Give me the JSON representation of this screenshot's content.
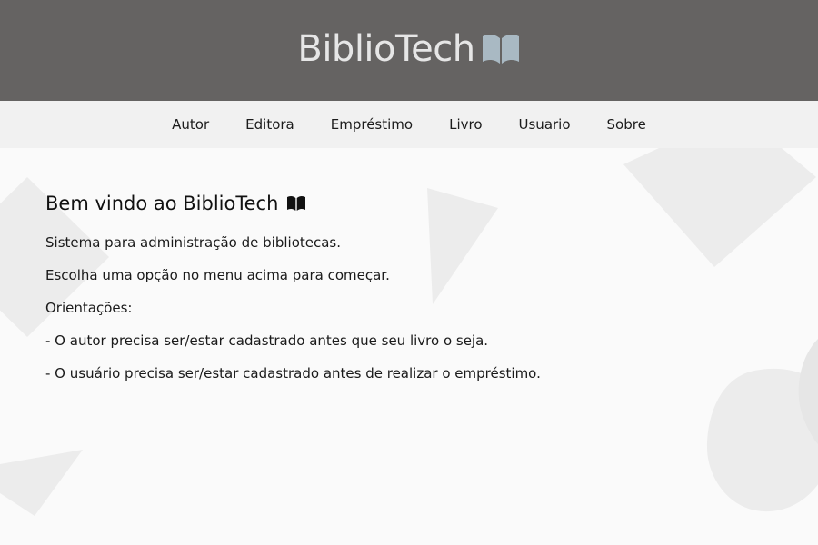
{
  "header": {
    "logo_text": "BiblioTech",
    "logo_icon": "open-book-icon"
  },
  "nav": {
    "items": [
      {
        "label": "Autor"
      },
      {
        "label": "Editora"
      },
      {
        "label": "Empréstimo"
      },
      {
        "label": "Livro"
      },
      {
        "label": "Usuario"
      },
      {
        "label": "Sobre"
      }
    ]
  },
  "main": {
    "title": "Bem vindo ao BiblioTech",
    "title_icon": "open-book-icon",
    "paragraphs": [
      "Sistema para administração de bibliotecas.",
      "Escolha uma opção no menu acima para começar.",
      "Orientações:",
      "- O autor precisa ser/estar cadastrado antes que seu livro o seja.",
      "- O usuário precisa ser/estar cadastrado antes de realizar o empréstimo."
    ]
  },
  "colors": {
    "header_bg": "#656362",
    "nav_bg": "#f1f1f1",
    "page_bg": "#fafafa",
    "logo_text": "#e6e6e6",
    "logo_icon": "#a9b9c3",
    "shape": "#e9e9e9"
  }
}
